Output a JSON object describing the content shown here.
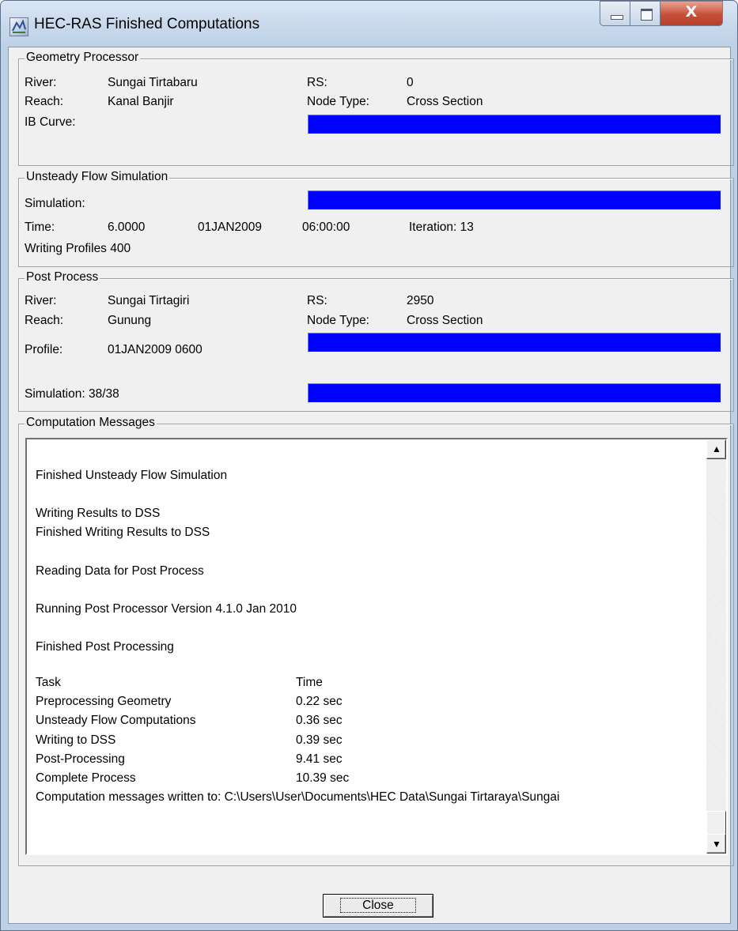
{
  "window": {
    "title": "HEC-RAS Finished Computations",
    "close_glyph": "X"
  },
  "geometry": {
    "legend": "Geometry Processor",
    "river_label": "River:",
    "river_value": "Sungai Tirtabaru",
    "reach_label": "Reach:",
    "reach_value": "Kanal Banjir",
    "ib_label": "IB Curve:",
    "rs_label": "RS:",
    "rs_value": "0",
    "node_label": "Node Type:",
    "node_value": "Cross Section",
    "progress": 1.0
  },
  "unsteady": {
    "legend": "Unsteady Flow Simulation",
    "simulation_label": "Simulation:",
    "time_label": "Time:",
    "time_value": "6.0000",
    "date_value": "01JAN2009",
    "clock_value": "06:00:00",
    "iteration_text": "Iteration: 13",
    "writing_text": "Writing Profiles  400",
    "progress": 1.0
  },
  "post": {
    "legend": "Post Process",
    "river_label": "River:",
    "river_value": "Sungai Tirtagiri",
    "reach_label": "Reach:",
    "reach_value": "Gunung",
    "profile_label": "Profile:",
    "profile_value": "01JAN2009 0600",
    "rs_label": "RS:",
    "rs_value": "2950",
    "node_label": "Node Type:",
    "node_value": "Cross Section",
    "simulation_text": "Simulation:  38/38",
    "profile_progress": 1.0,
    "simulation_progress": 1.0
  },
  "messages": {
    "legend": "Computation Messages",
    "lines": [
      "",
      "Finished Unsteady Flow Simulation",
      "",
      "Writing Results to DSS",
      "Finished Writing Results to DSS",
      "",
      "Reading Data for Post Process",
      "",
      "Running Post Processor  Version 4.1.0 Jan 2010",
      "",
      "Finished Post Processing",
      ""
    ],
    "table": [
      {
        "task": "Task",
        "time": "Time"
      },
      {
        "task": "Preprocessing Geometry",
        "time": "0.22 sec"
      },
      {
        "task": "Unsteady Flow Computations",
        "time": "0.36 sec"
      },
      {
        "task": "Writing to DSS",
        "time": "0.39 sec"
      },
      {
        "task": "Post-Processing",
        "time": "9.41 sec"
      },
      {
        "task": "Complete Process",
        "time": "10.39 sec"
      }
    ],
    "last_line": "Computation messages written to: C:\\Users\\User\\Documents\\HEC Data\\Sungai Tirtaraya\\Sungai"
  },
  "buttons": {
    "close_label": "Close"
  },
  "colors": {
    "progress": "#0000ff",
    "face": "#f0f0f0"
  },
  "icons": {
    "app": "hec-ras-app-icon",
    "scroll_up": "triangle-up-icon",
    "scroll_down": "triangle-down-icon"
  }
}
